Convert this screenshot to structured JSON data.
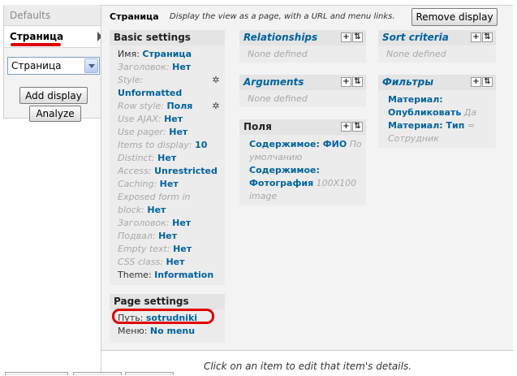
{
  "tabs": {
    "defaults": "Defaults",
    "active": "Страница"
  },
  "display_select": {
    "selected": "Страница"
  },
  "buttons": {
    "add_display": "Add display",
    "analyze": "Analyze",
    "remove_display": "Remove display"
  },
  "header": {
    "title": "Страница",
    "description": "Display the view as a page, with a URL and menu links."
  },
  "basic_settings": {
    "title": "Basic settings",
    "rows": [
      {
        "label": "Имя: ",
        "value": "Страница"
      },
      {
        "label": "Заголовок: ",
        "value": "Нет"
      },
      {
        "label": "Style: ",
        "value": ""
      },
      {
        "label": "",
        "value": "Unformatted"
      },
      {
        "label": "Row style: ",
        "value": "Поля"
      },
      {
        "label": "Use AJAX: ",
        "value": "Нет"
      },
      {
        "label": "Use pager: ",
        "value": "Нет"
      },
      {
        "label": "Items to display: ",
        "value": "10"
      },
      {
        "label": "Distinct: ",
        "value": "Нет"
      },
      {
        "label": "Access: ",
        "value": "Unrestricted"
      },
      {
        "label": "Caching: ",
        "value": "Нет"
      },
      {
        "label": "Exposed form in",
        "value": ""
      },
      {
        "label": "block: ",
        "value": "Нет"
      },
      {
        "label": "Заголовок: ",
        "value": "Нет"
      },
      {
        "label": "Подвал: ",
        "value": "Нет"
      },
      {
        "label": "Empty text: ",
        "value": "Нет"
      },
      {
        "label": "CSS class: ",
        "value": "Нет"
      },
      {
        "label": "Theme: ",
        "value": "Information"
      }
    ]
  },
  "page_settings": {
    "title": "Page settings",
    "rows": [
      {
        "label": "Путь: ",
        "value": "sotrudniki"
      },
      {
        "label": "Меню: ",
        "value": "No menu"
      }
    ]
  },
  "relationships": {
    "title": "Relationships",
    "empty": "None defined"
  },
  "arguments": {
    "title": "Arguments",
    "empty": "None defined"
  },
  "fields": {
    "title": "Поля",
    "items": [
      {
        "value": "Содержимое: ФИО",
        "rest": " По",
        "rest2": "умолчанию"
      },
      {
        "value": "Содержимое:",
        "value2": "Фотография",
        "rest": " 100X100",
        "rest2": "image"
      }
    ]
  },
  "sort_criteria": {
    "title": "Sort criteria",
    "empty": "None defined"
  },
  "filters": {
    "title": "Фильтры",
    "items": [
      {
        "value": "Материал:",
        "value2": "Опубликовать",
        "rest": " Да"
      },
      {
        "value": "Материал: Тип",
        "rest": " =",
        "rest2": "Сотрудник"
      }
    ]
  },
  "footer": {
    "hint": "Click on an item to edit that item's details."
  },
  "icons": {
    "gear": "gear-icon",
    "add": "plus-icon",
    "rearrange": "rearrange-icon"
  },
  "colors": {
    "link": "#0062a0",
    "highlight": "#e00000"
  }
}
